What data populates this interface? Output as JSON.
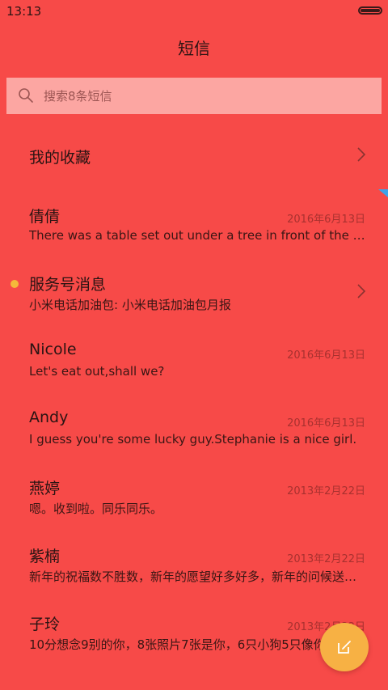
{
  "status_bar": {
    "time": "13:13"
  },
  "header": {
    "title": "短信"
  },
  "search": {
    "placeholder": "搜索8条短信",
    "icon": "search-icon"
  },
  "favorites": {
    "label": "我的收藏",
    "icon": "chevron-right-icon"
  },
  "conversations": [
    {
      "name": "倩倩",
      "date": "2016年6月13日",
      "preview": "There was a table set out under a tree in front of the house"
    },
    {
      "name": "服务号消息",
      "date": "",
      "preview": "小米电话加油包: 小米电话加油包月报",
      "unread": true,
      "has_chevron": true
    },
    {
      "name": "Nicole",
      "date": "2016年6月13日",
      "preview": "Let's eat out,shall we?"
    },
    {
      "name": "Andy",
      "date": "2016年6月13日",
      "preview": "I guess you're some lucky guy.Stephanie is a nice girl."
    },
    {
      "name": "燕婷",
      "date": "2013年2月22日",
      "preview": "嗯。收到啦。同乐同乐。"
    },
    {
      "name": "紫楠",
      "date": "2013年2月22日",
      "preview": "新年的祝福数不胜数，新年的愿望好多好多，新年的问候送给你"
    },
    {
      "name": "子玲",
      "date": "2013年2月22日",
      "preview": "10分想念9别的你，8张照片7张是你，6只小狗5只像你"
    }
  ],
  "fab": {
    "icon": "compose-icon"
  },
  "colors": {
    "background": "#F74A48",
    "search_box": "#FCA6A2",
    "unread_dot": "#F5B93A",
    "fab": "#F7B144",
    "date_text": "#A8312F"
  }
}
